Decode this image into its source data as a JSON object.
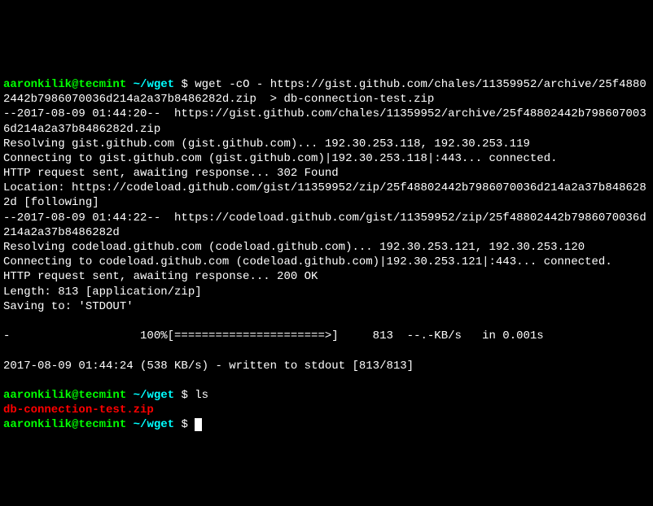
{
  "prompt": {
    "user": "aaronkilik",
    "host": "tecmint",
    "path": "~/wget",
    "symbol": "$"
  },
  "commands": {
    "wget": "wget -cO - https://gist.github.com/chales/11359952/archive/25f48802442b7986070036d214a2a37b8486282d.zip  > db-connection-test.zip",
    "ls": "ls"
  },
  "output": {
    "l1": "--2017-08-09 01:44:20--  https://gist.github.com/chales/11359952/archive/25f48802442b7986070036d214a2a37b8486282d.zip",
    "l2": "Resolving gist.github.com (gist.github.com)... 192.30.253.118, 192.30.253.119",
    "l3": "Connecting to gist.github.com (gist.github.com)|192.30.253.118|:443... connected.",
    "l4": "HTTP request sent, awaiting response... 302 Found",
    "l5": "Location: https://codeload.github.com/gist/11359952/zip/25f48802442b7986070036d214a2a37b8486282d [following]",
    "l6": "--2017-08-09 01:44:22--  https://codeload.github.com/gist/11359952/zip/25f48802442b7986070036d214a2a37b8486282d",
    "l7": "Resolving codeload.github.com (codeload.github.com)... 192.30.253.121, 192.30.253.120",
    "l8": "Connecting to codeload.github.com (codeload.github.com)|192.30.253.121|:443... connected.",
    "l9": "HTTP request sent, awaiting response... 200 OK",
    "l10": "Length: 813 [application/zip]",
    "l11": "Saving to: 'STDOUT'",
    "progress": "-                   100%[======================>]     813  --.-KB/s   in 0.001s",
    "final": "2017-08-09 01:44:24 (538 KB/s) - written to stdout [813/813]"
  },
  "ls_output": {
    "file": "db-connection-test.zip"
  }
}
